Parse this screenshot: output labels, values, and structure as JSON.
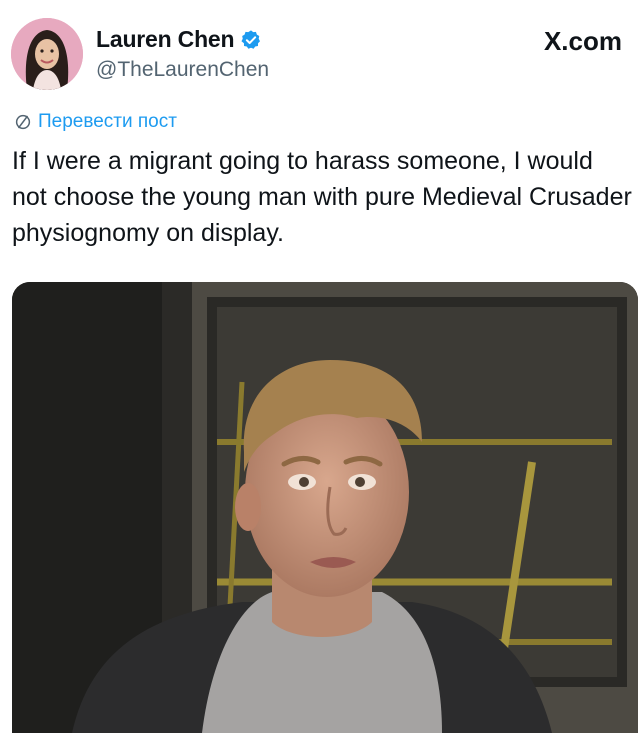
{
  "author": {
    "display_name": "Lauren Chen",
    "handle": "@TheLaurenChen",
    "verified": true,
    "avatar_icon": "profile-avatar"
  },
  "brand": {
    "label": "X.com",
    "icon": "x-logo-icon"
  },
  "translate": {
    "label": "Перевести пост",
    "icon": "globe-icon",
    "color": "#1d9bf0"
  },
  "post": {
    "text": "If I were a migrant going to harass someone, I would not choose the young man with pure Medieval Crusader physiognomy on display."
  },
  "media": {
    "kind": "photo",
    "subject": "young-man-on-bus"
  },
  "colors": {
    "accent": "#1d9bf0",
    "text_primary": "#0f1419",
    "text_secondary": "#536471"
  }
}
